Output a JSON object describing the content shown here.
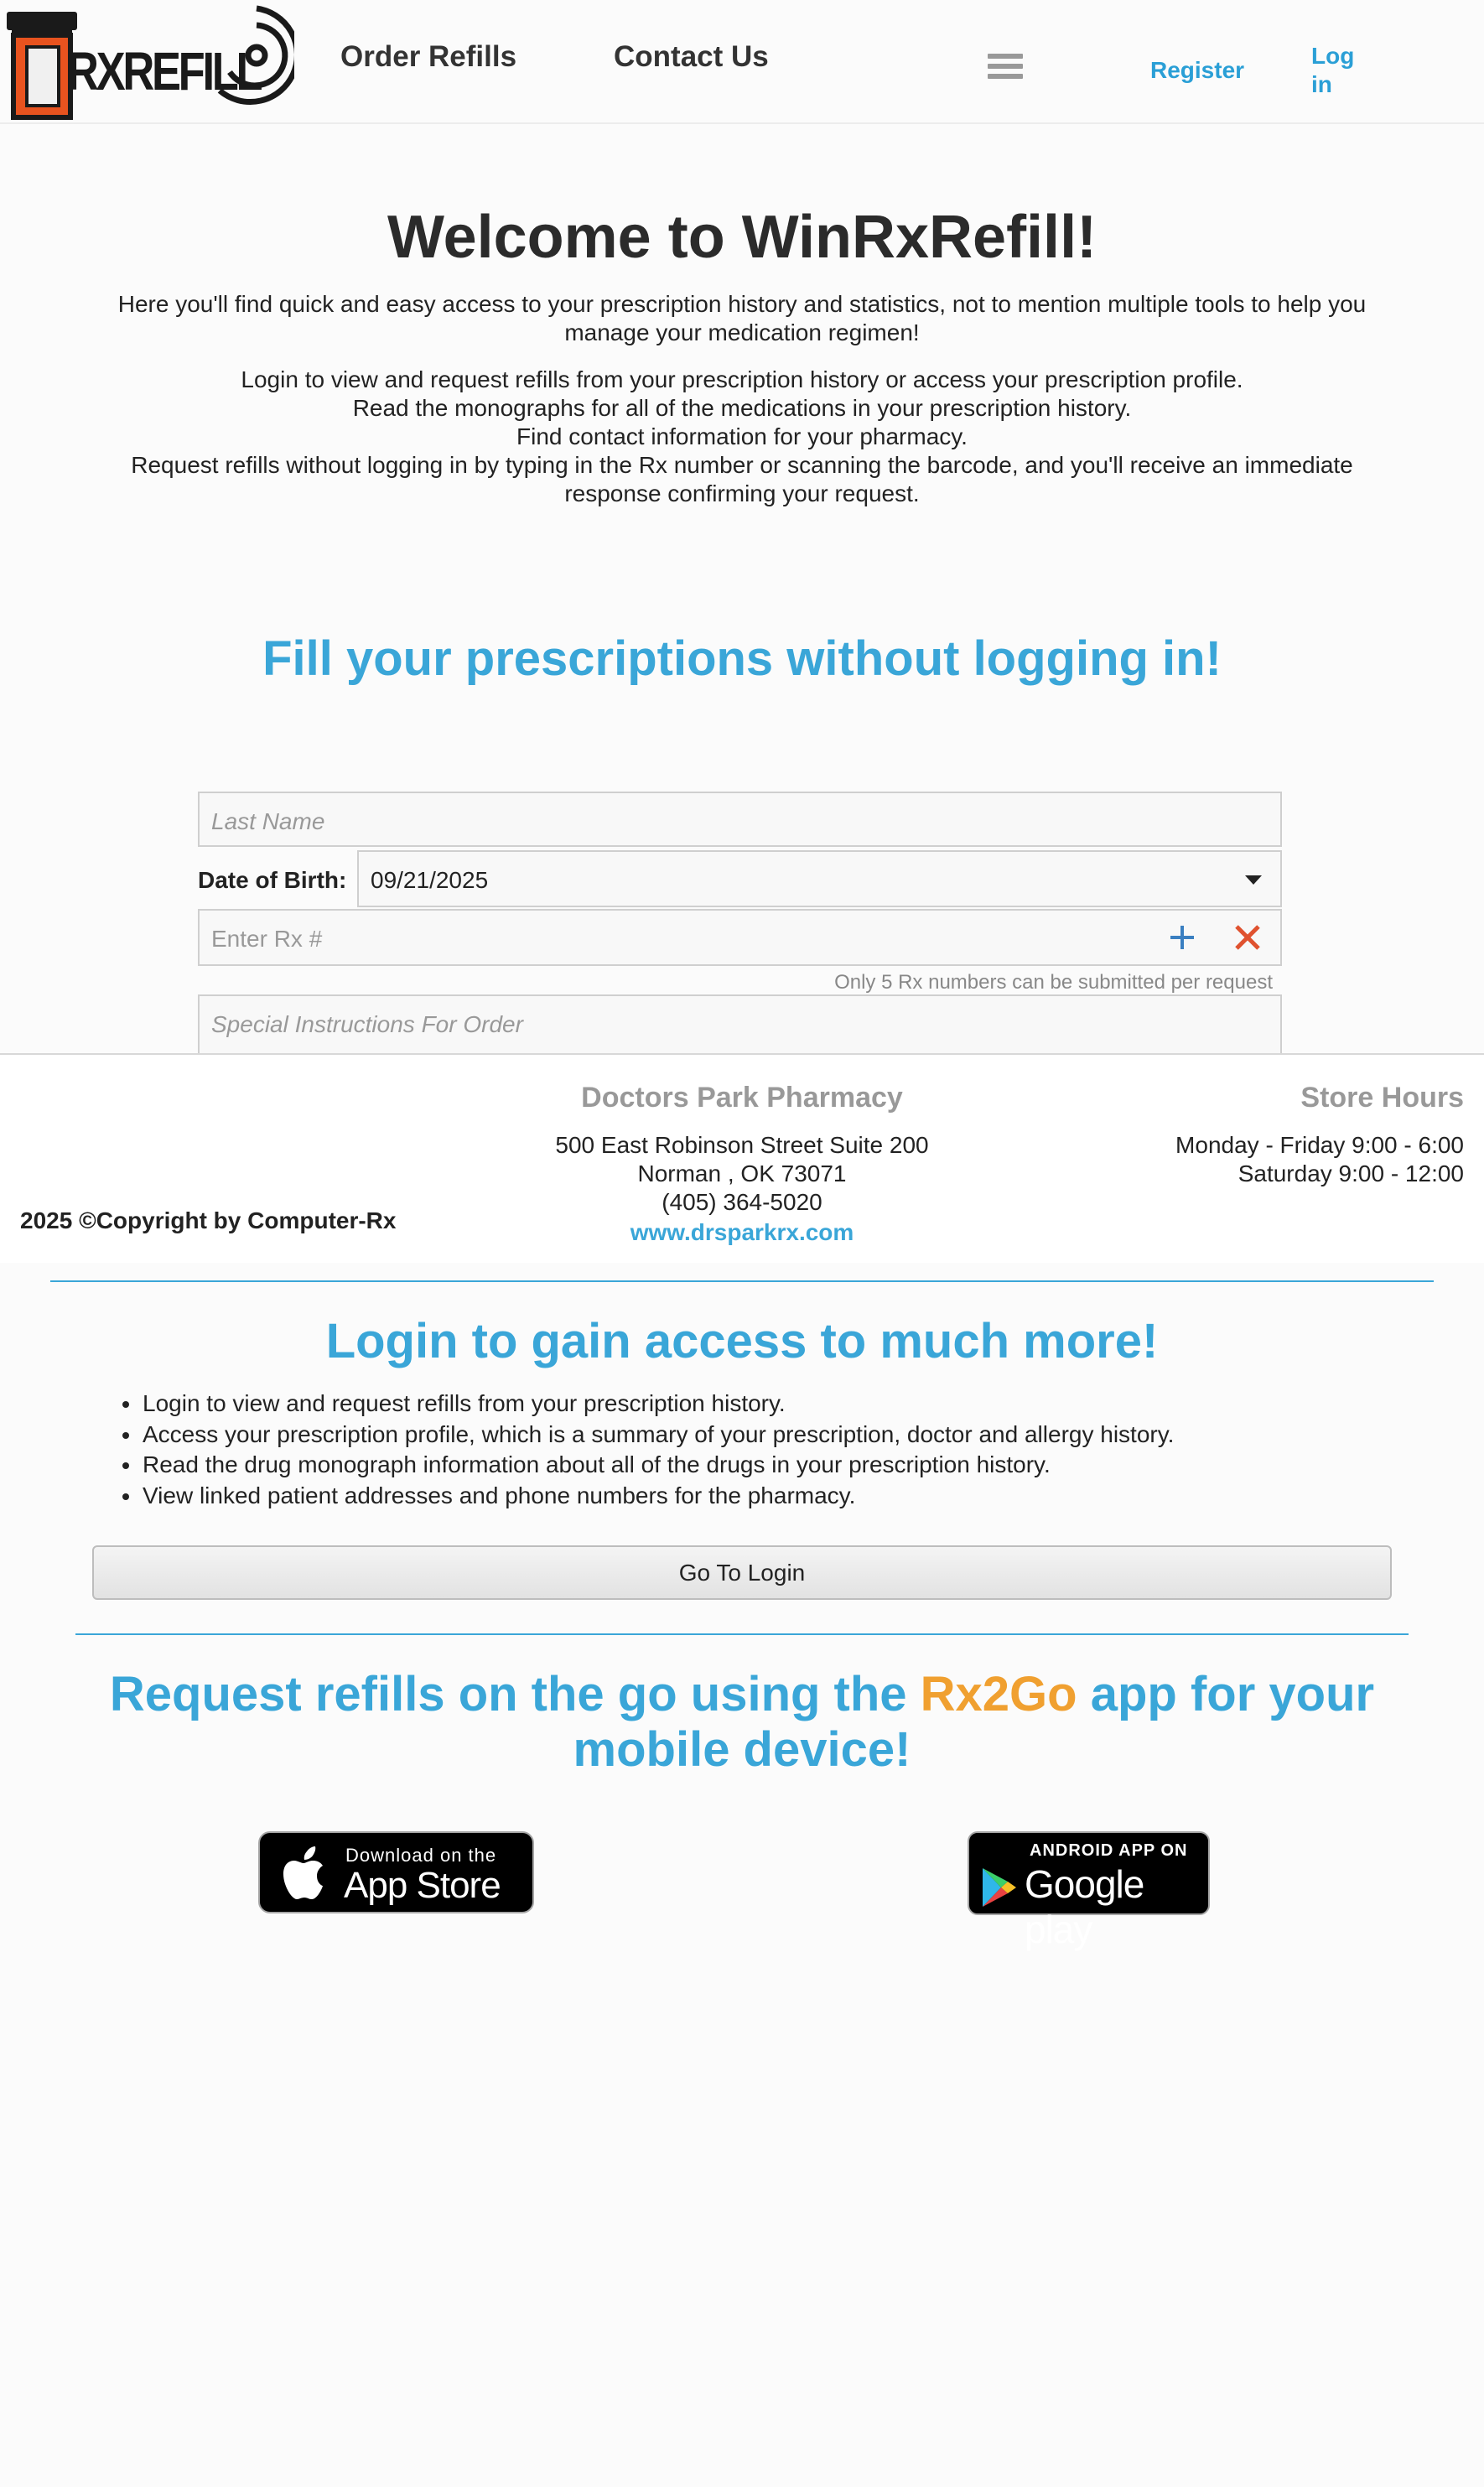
{
  "header": {
    "logo_text": "RXREFILL",
    "nav": [
      {
        "label": "Order Refills"
      },
      {
        "label": "Contact Us"
      }
    ],
    "register_label": "Register",
    "login_label": "Log in"
  },
  "intro": {
    "title": "Welcome to WinRxRefill!",
    "paragraph1": "Here you'll find quick and easy access to your prescription history and statistics, not to mention multiple tools to help you manage your medication regimen!",
    "lines": [
      "Login to view and request refills from your prescription history or access your prescription profile.",
      "Read the monographs for all of the medications in your prescription history.",
      "Find contact information for your pharmacy.",
      "Request refills without logging in by typing in the Rx number or scanning the barcode, and you'll receive an immediate response confirming your request."
    ]
  },
  "refill_form": {
    "title": "Fill your prescriptions without logging in!",
    "last_name_placeholder": "Last Name",
    "dob_label": "Date of Birth:",
    "dob_value": "09/21/2025",
    "rx_placeholder": "Enter Rx #",
    "rx_note": "Only 5 Rx numbers can be submitted per request",
    "instructions_placeholder": "Special Instructions For Order"
  },
  "footer": {
    "pharmacy_name": "Doctors Park Pharmacy",
    "address_line1": "500 East Robinson Street Suite 200",
    "address_line2": "Norman , OK 73071",
    "phone": "(405) 364-5020",
    "website": "www.drsparkrx.com",
    "hours_title": "Store Hours",
    "hours": [
      "Monday - Friday 9:00 - 6:00",
      "Saturday 9:00 - 12:00"
    ],
    "copyright": "2025 ©Copyright by Computer-Rx"
  },
  "login_promo": {
    "title": "Login to gain access to much more!",
    "bullets": [
      "Login to view and request refills from your prescription history.",
      "Access your prescription profile, which is a summary of your prescription, doctor and allergy history.",
      "Read the drug monograph information about all of the drugs in your prescription history.",
      "View linked patient addresses and phone numbers for the pharmacy."
    ],
    "button_label": "Go To Login"
  },
  "app_promo": {
    "title_before": "Request refills on the go using the ",
    "brand": "Rx2Go",
    "title_after": " app for your mobile device!",
    "appstore_small": "Download on the",
    "appstore_big": "App Store",
    "googleplay_small": "ANDROID APP ON",
    "googleplay_big": "Google play"
  },
  "colors": {
    "accent": "#3aa6d8",
    "brand_orange": "#f0a030",
    "logo_orange": "#e8531f",
    "remove_red": "#e0522f",
    "add_blue": "#3a7fc1"
  },
  "icons": [
    "pill-bottle-logo",
    "signal-icon",
    "hamburger-icon",
    "caret-down-icon",
    "plus-icon",
    "close-icon",
    "apple-icon",
    "google-play-icon"
  ]
}
